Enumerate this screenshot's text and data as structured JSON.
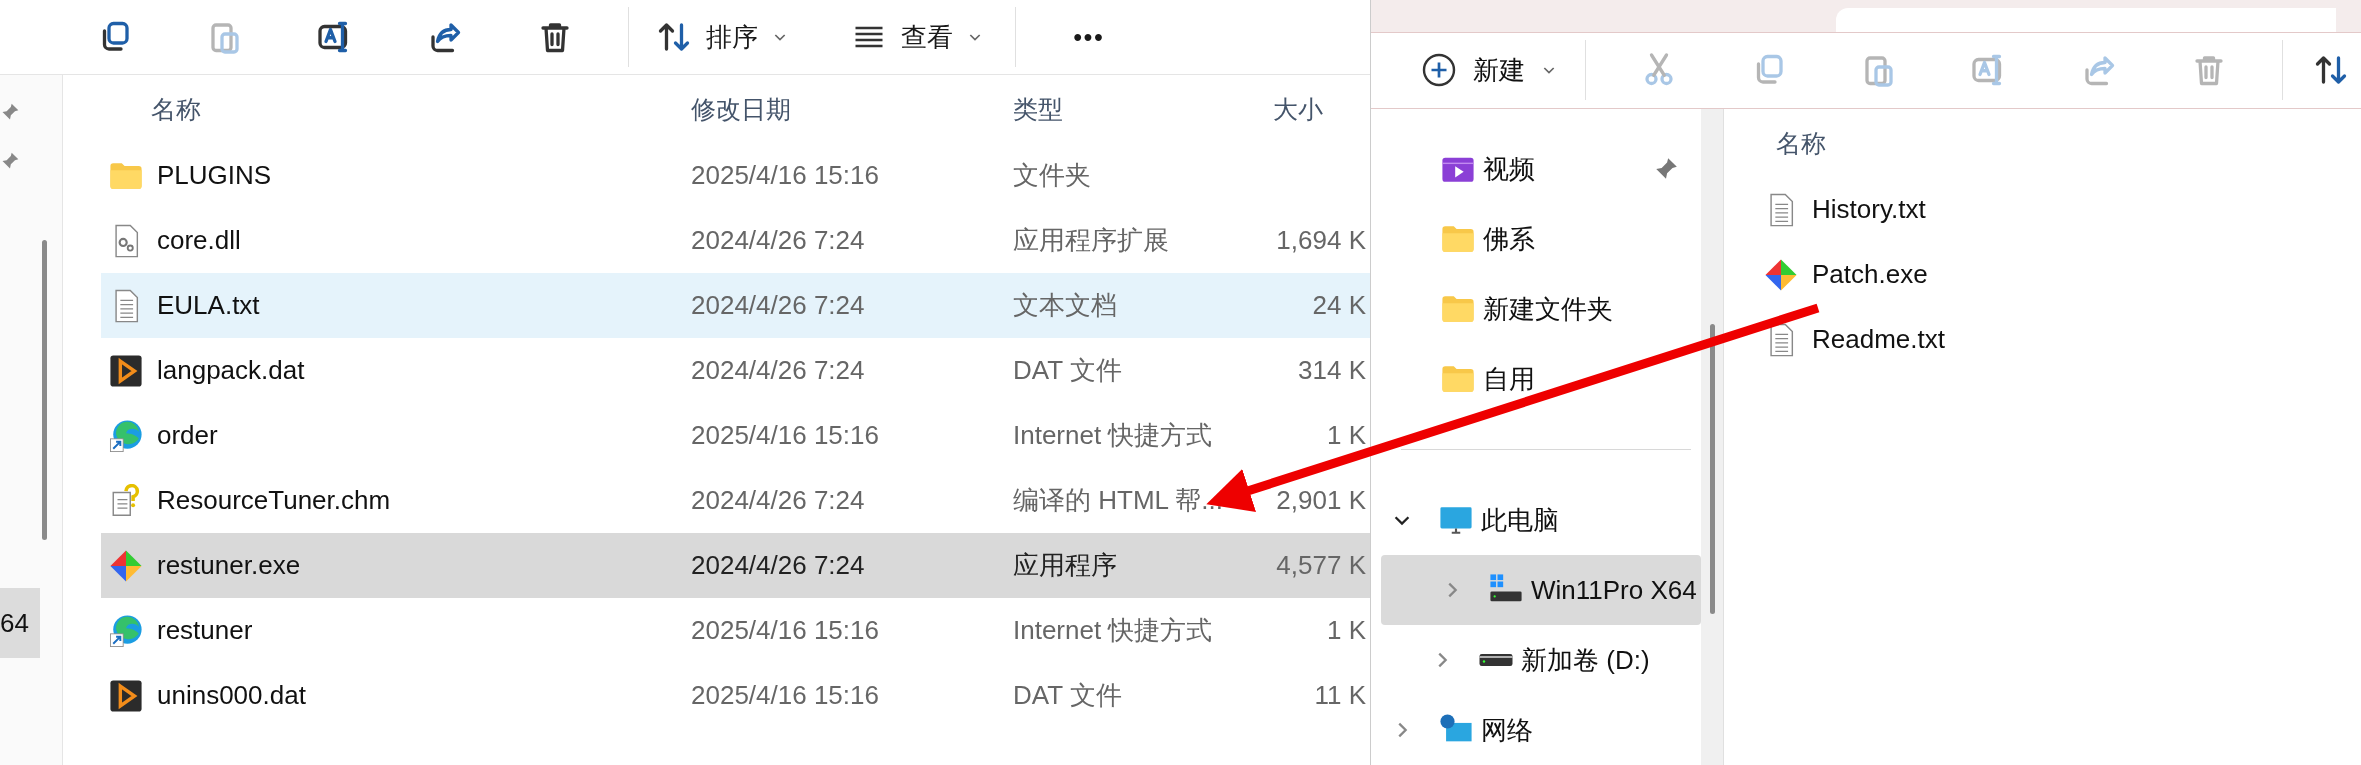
{
  "left_window": {
    "toolbar": [
      {
        "kind": "copy",
        "disabled": false
      },
      {
        "kind": "paste",
        "disabled": true
      },
      {
        "kind": "rename",
        "disabled": false
      },
      {
        "kind": "share",
        "disabled": false
      },
      {
        "kind": "delete",
        "disabled": false
      }
    ],
    "sort_button": "排序",
    "view_button": "查看",
    "more_button": "•••",
    "nav_stub": {
      "text": "64",
      "selected": true
    },
    "columns": [
      "名称",
      "修改日期",
      "类型",
      "大小"
    ],
    "rows": [
      {
        "kind": "folder",
        "name": "PLUGINS",
        "modified": "2025/4/16 15:16",
        "type": "文件夹",
        "size": "",
        "selected": false,
        "hovered": false
      },
      {
        "kind": "dll",
        "name": "core.dll",
        "modified": "2024/4/26 7:24",
        "type": "应用程序扩展",
        "size": "1,694 K",
        "selected": false,
        "hovered": false
      },
      {
        "kind": "text",
        "name": "EULA.txt",
        "modified": "2024/4/26 7:24",
        "type": "文本文档",
        "size": "24 K",
        "selected": false,
        "hovered": true
      },
      {
        "kind": "dat",
        "name": "langpack.dat",
        "modified": "2024/4/26 7:24",
        "type": "DAT 文件",
        "size": "314 K",
        "selected": false,
        "hovered": false
      },
      {
        "kind": "link",
        "name": "order",
        "modified": "2025/4/16 15:16",
        "type": "Internet 快捷方式",
        "size": "1 K",
        "selected": false,
        "hovered": false
      },
      {
        "kind": "help",
        "name": "ResourceTuner.chm",
        "modified": "2024/4/26 7:24",
        "type": "编译的 HTML 帮...",
        "size": "2,901 K",
        "selected": false,
        "hovered": false
      },
      {
        "kind": "exe",
        "name": "restuner.exe",
        "modified": "2024/4/26 7:24",
        "type": "应用程序",
        "size": "4,577 K",
        "selected": true,
        "hovered": false
      },
      {
        "kind": "link",
        "name": "restuner",
        "modified": "2025/4/16 15:16",
        "type": "Internet 快捷方式",
        "size": "1 K",
        "selected": false,
        "hovered": false
      },
      {
        "kind": "dat",
        "name": "unins000.dat",
        "modified": "2025/4/16 15:16",
        "type": "DAT 文件",
        "size": "11 K",
        "selected": false,
        "hovered": false
      }
    ]
  },
  "right_window": {
    "new_button": "新建",
    "toolbar": [
      {
        "kind": "cut",
        "disabled": true
      },
      {
        "kind": "copy",
        "disabled": true
      },
      {
        "kind": "paste",
        "disabled": true
      },
      {
        "kind": "rename",
        "disabled": true
      },
      {
        "kind": "share",
        "disabled": true
      },
      {
        "kind": "delete",
        "disabled": true
      },
      {
        "kind": "sort",
        "disabled": false
      }
    ],
    "quick_access": [
      {
        "kind": "video",
        "label": "视频",
        "pinned": true
      },
      {
        "kind": "folder",
        "label": "佛系",
        "pinned": false
      },
      {
        "kind": "folder",
        "label": "新建文件夹",
        "pinned": false
      },
      {
        "kind": "folder",
        "label": "自用",
        "pinned": false
      }
    ],
    "tree": [
      {
        "kind": "pc",
        "label": "此电脑",
        "expanded": true,
        "selected": false,
        "children": [
          {
            "kind": "system-drive",
            "label": "Win11Pro X64",
            "expanded": false,
            "selected": true
          },
          {
            "kind": "drive",
            "label": "新加卷 (D:)",
            "expanded": false,
            "selected": false
          }
        ]
      },
      {
        "kind": "network",
        "label": "网络",
        "expanded": false,
        "selected": false
      }
    ],
    "column": "名称",
    "files": [
      {
        "kind": "text",
        "name": "History.txt"
      },
      {
        "kind": "exe",
        "name": "Patch.exe"
      },
      {
        "kind": "text",
        "name": "Readme.txt"
      }
    ]
  }
}
